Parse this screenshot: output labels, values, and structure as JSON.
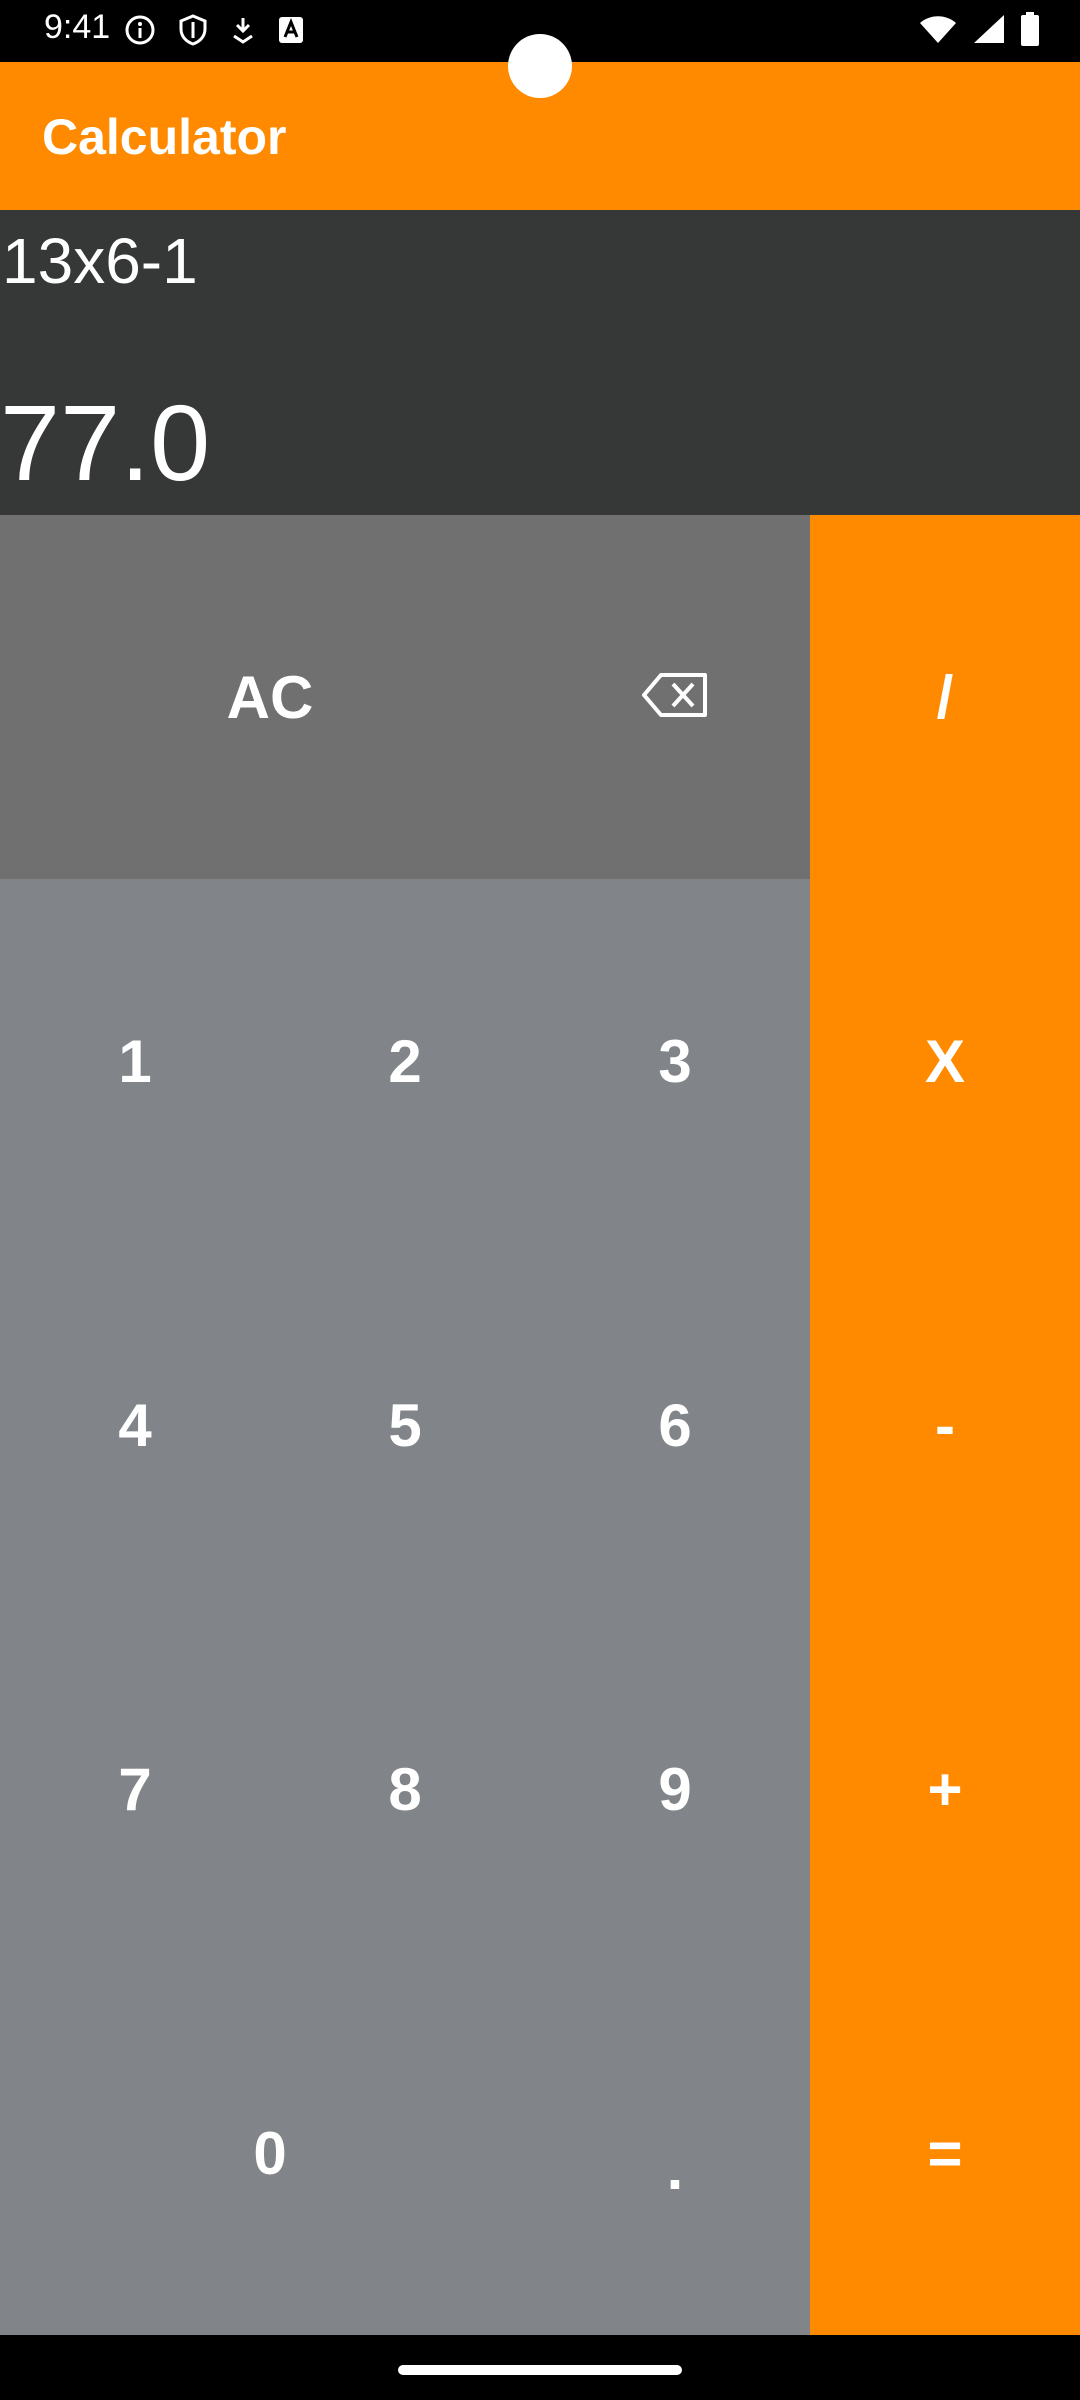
{
  "status_bar": {
    "time": "9:41",
    "left_icons": [
      "info-icon",
      "shield-icon",
      "download-icon",
      "text-icon"
    ],
    "right_icons": [
      "wifi-icon",
      "signal-icon",
      "battery-icon"
    ]
  },
  "app_bar": {
    "title": "Calculator"
  },
  "display": {
    "expression": "13x6-1",
    "result": "77.0"
  },
  "keys": {
    "clear": "AC",
    "divide": "/",
    "one": "1",
    "two": "2",
    "three": "3",
    "multiply": "X",
    "four": "4",
    "five": "5",
    "six": "6",
    "subtract": "-",
    "seven": "7",
    "eight": "8",
    "nine": "9",
    "add": "+",
    "zero": "0",
    "decimal": ".",
    "equals": "="
  },
  "colors": {
    "accent": "#ff8a00",
    "display_bg": "#363737",
    "function_key_bg": "#707070",
    "number_key_bg": "#818488"
  }
}
